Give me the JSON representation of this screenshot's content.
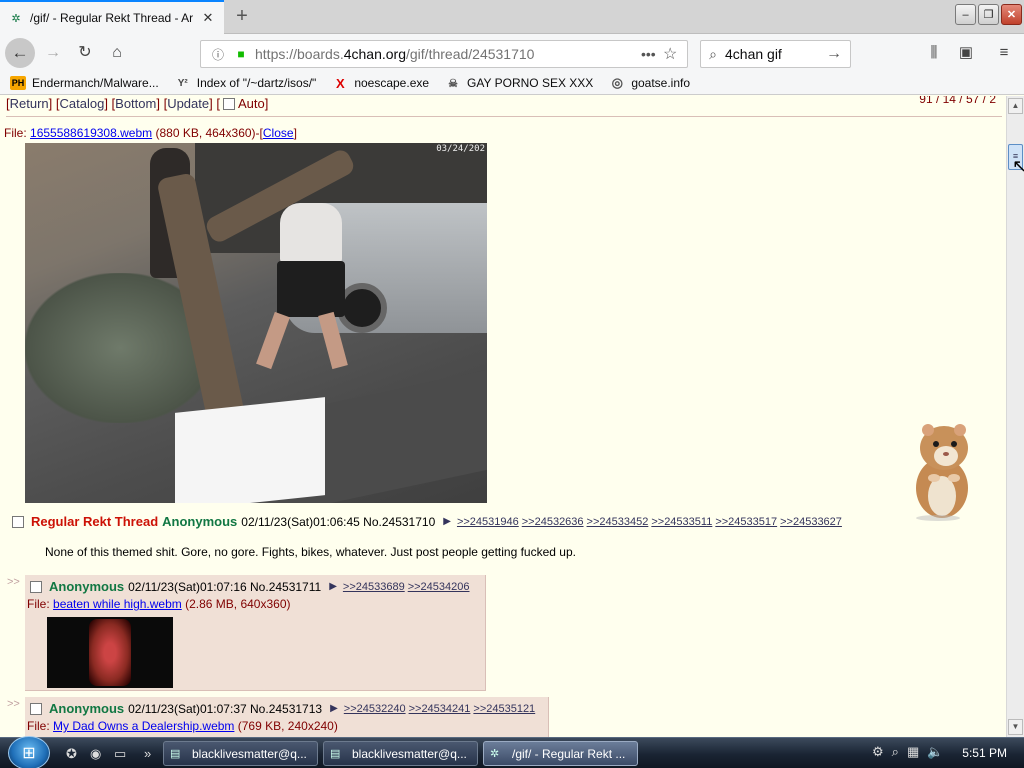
{
  "tab": {
    "title": "/gif/ - Regular Rekt Thread - Ar",
    "favicon": "clover-icon"
  },
  "window": {
    "minimize": "–",
    "maximize": "❐",
    "close": "✕"
  },
  "nav": {
    "url_pre": "https://boards.",
    "url_domain": "4chan.org",
    "url_post": "/gif/thread/24531710",
    "search_value": "4chan gif"
  },
  "bookmarks": [
    {
      "badge": "PH",
      "label": "Endermanch/Malware..."
    },
    {
      "badge": "Y²",
      "label": "Index of \"/~dartz/isos/\""
    },
    {
      "badge": "X",
      "label": "noescape.exe"
    },
    {
      "badge": "☠",
      "label": "GAY PORNO SEX XXX"
    },
    {
      "badge": "◎",
      "label": "goatse.info"
    }
  ],
  "thread_nav": {
    "return": "Return",
    "catalog": "Catalog",
    "bottom": "Bottom",
    "update": "Update",
    "auto": "Auto",
    "stats": "91 / 14 / 57 / 2"
  },
  "op_file": {
    "prefix": "File: ",
    "name": "1655588619308.webm",
    "meta": "(880 KB, 464x360)-",
    "close": "Close",
    "timestamp": "03/24/202"
  },
  "op": {
    "subject": "Regular Rekt Thread",
    "name": "Anonymous",
    "datetime": "02/11/23(Sat)01:06:45",
    "no": "No.24531710",
    "backlinks": [
      ">>24531946",
      ">>24532636",
      ">>24533452",
      ">>24533511",
      ">>24533517",
      ">>24533627"
    ],
    "body": "None of this themed shit. Gore, no gore. Fights, bikes, whatever. Just post people getting fucked up."
  },
  "replies": [
    {
      "side": ">>",
      "name": "Anonymous",
      "datetime": "02/11/23(Sat)01:07:16",
      "no": "No.24531711",
      "backlinks": [
        ">>24533689",
        ">>24534206"
      ],
      "file_prefix": "File: ",
      "file_name": "beaten while high.webm",
      "file_meta": "(2.86 MB, 640x360)"
    },
    {
      "side": ">>",
      "name": "Anonymous",
      "datetime": "02/11/23(Sat)01:07:37",
      "no": "No.24531713",
      "backlinks": [
        ">>24532240",
        ">>24534241",
        ">>24535121"
      ],
      "file_prefix": "File: ",
      "file_name": "My Dad Owns a Dealership.webm",
      "file_meta": "(769 KB, 240x240)"
    }
  ],
  "taskbar": {
    "items": [
      {
        "label": "blacklivesmatter@q...",
        "active": false
      },
      {
        "label": "blacklivesmatter@q...",
        "active": false
      },
      {
        "label": "/gif/ - Regular Rekt ...",
        "active": true
      }
    ],
    "clock": "5:51 PM"
  }
}
